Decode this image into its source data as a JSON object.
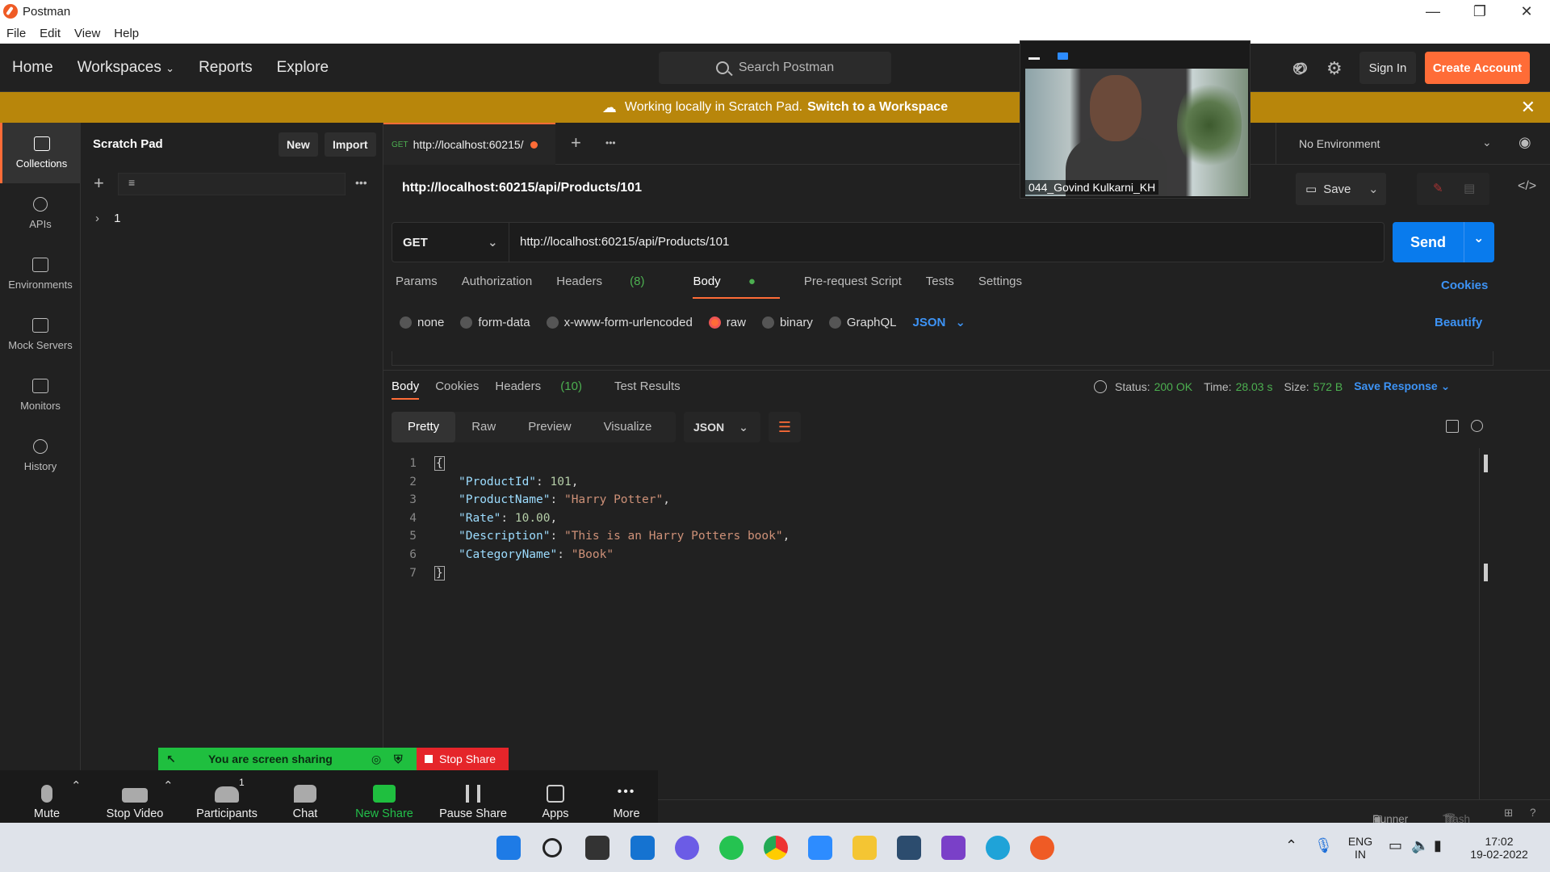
{
  "window": {
    "title": "Postman",
    "menu": [
      "File",
      "Edit",
      "View",
      "Help"
    ],
    "controls": [
      "—",
      "❐",
      "✕"
    ]
  },
  "header": {
    "nav": [
      "Home",
      "Workspaces",
      "Reports",
      "Explore"
    ],
    "search_placeholder": "Search Postman",
    "signin_label": "Sign In",
    "create_label": "Create Account"
  },
  "banner": {
    "text": "Working locally in Scratch Pad.",
    "link": "Switch to a Workspace"
  },
  "sidebar": {
    "items": [
      "Collections",
      "APIs",
      "Environments",
      "Mock Servers",
      "Monitors",
      "History"
    ]
  },
  "scratch": {
    "title": "Scratch Pad",
    "new_label": "New",
    "import_label": "Import",
    "tree_item": "1"
  },
  "tab": {
    "method": "GET",
    "label": "http://localhost:60215/"
  },
  "environment": "No Environment",
  "request": {
    "title": "http://localhost:60215/api/Products/101",
    "save_label": "Save",
    "method": "GET",
    "url": "http://localhost:60215/api/Products/101",
    "send_label": "Send",
    "tabs": {
      "params": "Params",
      "authorization": "Authorization",
      "headers": "Headers",
      "headers_count": "(8)",
      "body": "Body",
      "pre_request": "Pre-request Script",
      "tests": "Tests",
      "settings": "Settings"
    },
    "cookies_label": "Cookies",
    "body_types": [
      "none",
      "form-data",
      "x-www-form-urlencoded",
      "raw",
      "binary",
      "GraphQL"
    ],
    "raw_format": "JSON",
    "beautify_label": "Beautify"
  },
  "response": {
    "tabs": {
      "body": "Body",
      "cookies": "Cookies",
      "headers": "Headers",
      "headers_count": "(10)",
      "test_results": "Test Results"
    },
    "status_label": "Status:",
    "status_value": "200 OK",
    "time_label": "Time:",
    "time_value": "28.03 s",
    "size_label": "Size:",
    "size_value": "572 B",
    "save_response_label": "Save Response",
    "views": [
      "Pretty",
      "Raw",
      "Preview",
      "Visualize"
    ],
    "format": "JSON",
    "lines": [
      {
        "n": "1",
        "open": "{"
      },
      {
        "n": "2",
        "key": "\"ProductId\"",
        "val": "101",
        "type": "num"
      },
      {
        "n": "3",
        "key": "\"ProductName\"",
        "val": "\"Harry Potter\"",
        "type": "str"
      },
      {
        "n": "4",
        "key": "\"Rate\"",
        "val": "10.00",
        "type": "num"
      },
      {
        "n": "5",
        "key": "\"Description\"",
        "val": "\"This is an Harry Potters book\"",
        "type": "str"
      },
      {
        "n": "6",
        "key": "\"CategoryName\"",
        "val": "\"Book\"",
        "type": "str",
        "last": true
      },
      {
        "n": "7",
        "open": "}"
      }
    ]
  },
  "statusbar": {
    "runner": "Runner",
    "trash": "Trash"
  },
  "zoom": {
    "sharing_text": "You are screen sharing",
    "stop_share": "Stop Share",
    "controls": [
      "Mute",
      "Stop Video",
      "Participants",
      "Chat",
      "New Share",
      "Pause Share",
      "Apps",
      "More"
    ],
    "participants_count": "1",
    "video_name": "044_Govind Kulkarni_KH"
  },
  "taskbar": {
    "lang_top": "ENG",
    "lang_bottom": "IN",
    "time": "17:02",
    "date": "19-02-2022"
  },
  "colors": {
    "accent": "#ff6c37",
    "send": "#097bed",
    "banner": "#b8860b",
    "status_ok": "#4caf50"
  }
}
